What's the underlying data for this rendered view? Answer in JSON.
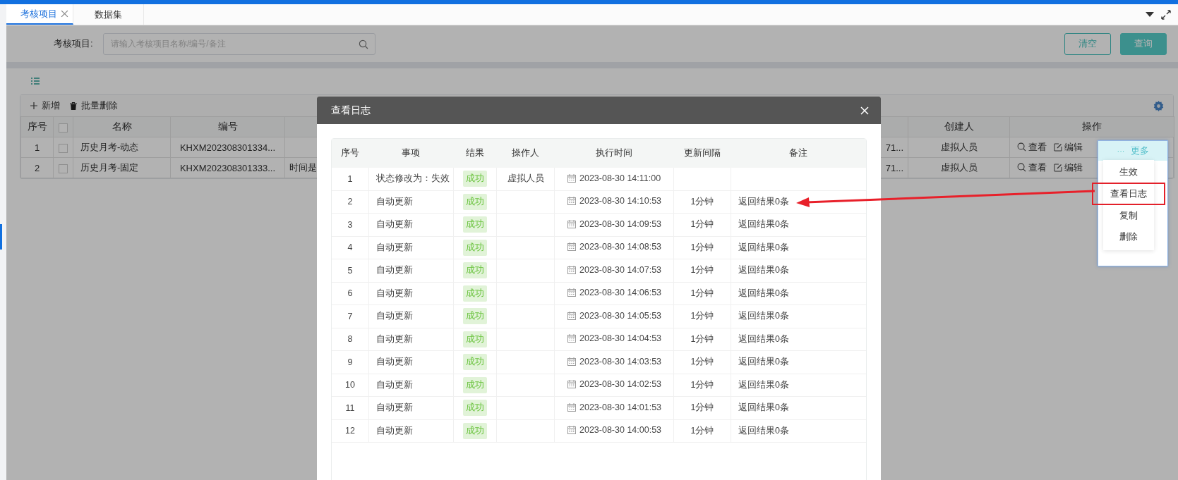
{
  "tabs": [
    {
      "label": "考核项目",
      "selected": true,
      "closable": true
    },
    {
      "label": "数据集",
      "selected": false,
      "closable": false
    }
  ],
  "filter": {
    "label": "考核项目:",
    "placeholder": "请输入考核项目名称/编号/备注"
  },
  "buttons": [
    {
      "label": "清空",
      "kind": "outline"
    },
    {
      "label": "查询",
      "kind": "primary"
    }
  ],
  "toolbar": [
    {
      "label": "新增",
      "kind": "add"
    },
    {
      "label": "批量删除",
      "kind": "delete"
    }
  ],
  "table": {
    "columns": [
      {
        "kind": "text",
        "label": "序号"
      },
      {
        "kind": "checkbox",
        "checked": false
      },
      {
        "kind": "text",
        "label": "名称"
      },
      {
        "kind": "text",
        "label": "编号"
      },
      {
        "kind": "blank"
      },
      {
        "kind": "blank"
      },
      {
        "kind": "text",
        "label": "创建人"
      },
      {
        "kind": "text",
        "label": "操作"
      }
    ],
    "rows": [
      {
        "index": "1",
        "checked": false,
        "name": "历史月考-动态",
        "code": "KHXM202308301334...",
        "column_6": "71...",
        "creator": "虚拟人员",
        "actions": [
          {
            "label": "查看",
            "kind": "view"
          },
          {
            "label": "编辑",
            "kind": "edit"
          }
        ]
      },
      {
        "index": "2",
        "checked": false,
        "name": "历史月考-固定",
        "code": "KHXM202308301333...",
        "column_5": "时间是",
        "column_6": "71...",
        "creator": "虚拟人员",
        "actions": [
          {
            "label": "查看",
            "kind": "view"
          },
          {
            "label": "编辑",
            "kind": "edit"
          }
        ]
      }
    ]
  },
  "more_menu": {
    "trigger": "···",
    "label": "更多",
    "items": [
      {
        "label": "生效",
        "highlighted": false
      },
      {
        "label": "查看日志",
        "highlighted": true
      },
      {
        "label": "复制",
        "highlighted": false
      },
      {
        "label": "删除",
        "highlighted": false
      }
    ]
  },
  "dialog": {
    "title": "查看日志",
    "columns": [
      "序号",
      "事项",
      "结果",
      "操作人",
      "执行时间",
      "更新间隔",
      "备注"
    ],
    "rows": [
      {
        "index": "1",
        "item": "状态修改为：失效",
        "result": "成功",
        "operator": "虚拟人员",
        "time": "2023-08-30 14:11:00"
      },
      {
        "index": "2",
        "item": "自动更新",
        "result": "成功",
        "time": "2023-08-30 14:10:53",
        "interval": "1分钟",
        "remark": "返回结果0条"
      },
      {
        "index": "3",
        "item": "自动更新",
        "result": "成功",
        "time": "2023-08-30 14:09:53",
        "interval": "1分钟",
        "remark": "返回结果0条"
      },
      {
        "index": "4",
        "item": "自动更新",
        "result": "成功",
        "time": "2023-08-30 14:08:53",
        "interval": "1分钟",
        "remark": "返回结果0条"
      },
      {
        "index": "5",
        "item": "自动更新",
        "result": "成功",
        "time": "2023-08-30 14:07:53",
        "interval": "1分钟",
        "remark": "返回结果0条"
      },
      {
        "index": "6",
        "item": "自动更新",
        "result": "成功",
        "time": "2023-08-30 14:06:53",
        "interval": "1分钟",
        "remark": "返回结果0条"
      },
      {
        "index": "7",
        "item": "自动更新",
        "result": "成功",
        "time": "2023-08-30 14:05:53",
        "interval": "1分钟",
        "remark": "返回结果0条"
      },
      {
        "index": "8",
        "item": "自动更新",
        "result": "成功",
        "time": "2023-08-30 14:04:53",
        "interval": "1分钟",
        "remark": "返回结果0条"
      },
      {
        "index": "9",
        "item": "自动更新",
        "result": "成功",
        "time": "2023-08-30 14:03:53",
        "interval": "1分钟",
        "remark": "返回结果0条"
      },
      {
        "index": "10",
        "item": "自动更新",
        "result": "成功",
        "time": "2023-08-30 14:02:53",
        "interval": "1分钟",
        "remark": "返回结果0条"
      },
      {
        "index": "11",
        "item": "自动更新",
        "result": "成功",
        "time": "2023-08-30 14:01:53",
        "interval": "1分钟",
        "remark": "返回结果0条"
      },
      {
        "index": "12",
        "item": "自动更新",
        "result": "成功",
        "time": "2023-08-30 14:00:53",
        "interval": "1分钟",
        "remark": "返回结果0条"
      }
    ]
  }
}
